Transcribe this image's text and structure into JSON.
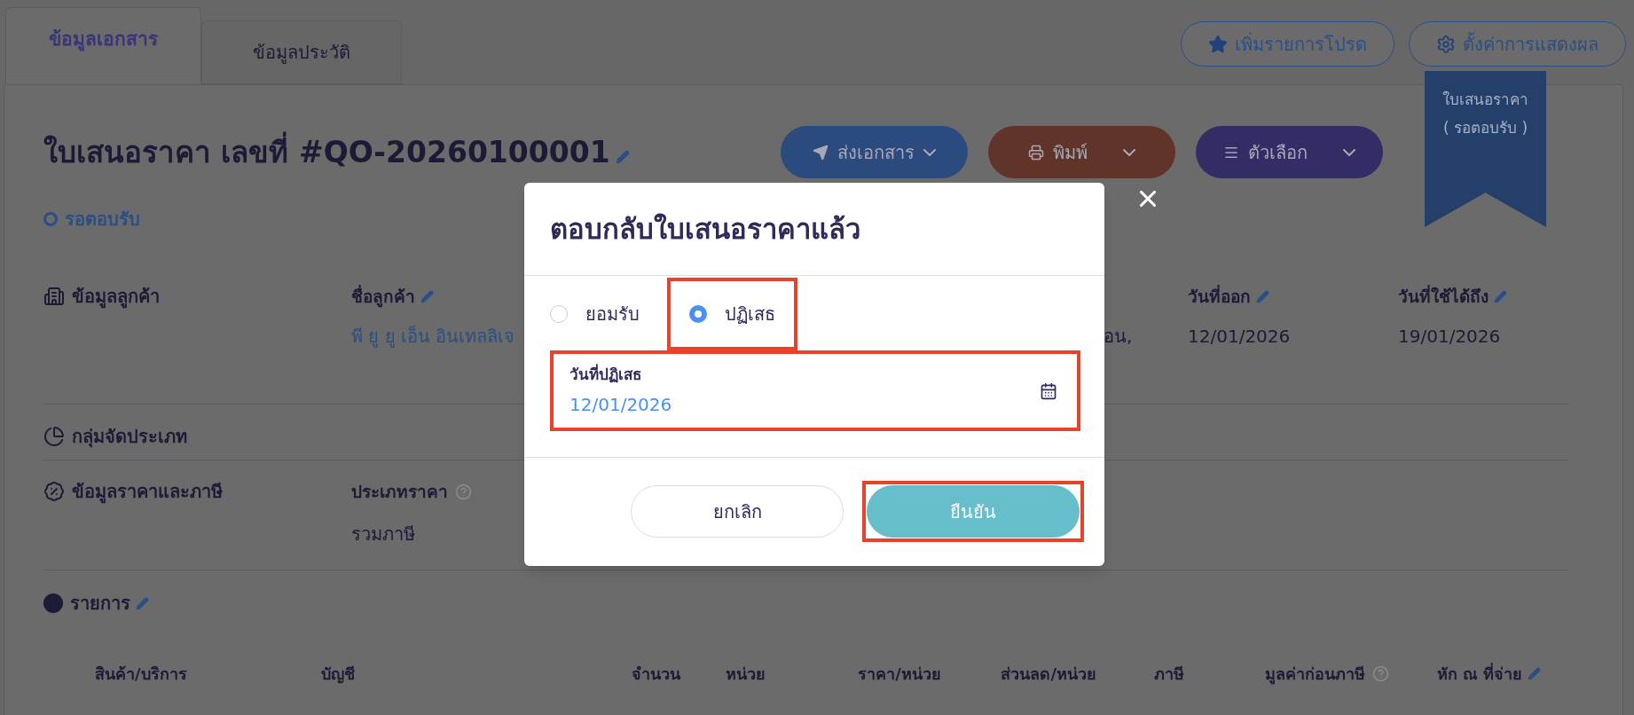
{
  "tabs": [
    {
      "label": "ข้อมูลเอกสาร",
      "selected": true
    },
    {
      "label": "ข้อมูลประวัติ",
      "selected": false
    }
  ],
  "header_buttons": [
    {
      "label": "เพิ่มรายการโปรด"
    },
    {
      "label": "ตั้งค่าการแสดงผล"
    }
  ],
  "ribbon": {
    "lines": [
      "ใบเสนอราคา",
      "( รอตอบรับ )"
    ]
  },
  "document": {
    "title": "ใบเสนอราคา เลขที่ #QO-20260100001",
    "status": "รอตอบรับ"
  },
  "actions": [
    {
      "label": "ส่งเอกสาร",
      "color": "#2b4a7e"
    },
    {
      "label": "พิมพ์",
      "color": "#603428"
    },
    {
      "label": "ตัวเลือก",
      "color": "#322d64"
    }
  ],
  "customer": {
    "title": "ข้อมูลลูกค้า",
    "fields": [
      {
        "label": "ชื่อลูกค้า",
        "value": "พี ยู ยู เอ็น อินเทลลิเจ"
      },
      {
        "value": "อน,"
      },
      {
        "label": "วันที่ออก",
        "value": "12/01/2026"
      },
      {
        "label": "วันที่ใช้ได้ถึง",
        "value": "19/01/2026"
      }
    ]
  },
  "category": {
    "title": "กลุ่มจัดประเภท"
  },
  "pricing": {
    "title": "ข้อมูลราคาและภาษี",
    "field": {
      "label": "ประเภทราคา",
      "value": "รวมภาษี"
    }
  },
  "items": {
    "title": "รายการ",
    "columns": [
      "สินค้า/บริการ",
      "บัญชี",
      "จำนวน",
      "หน่วย",
      "ราคา/หน่วย",
      "ส่วนลด/หน่วย",
      "ภาษี",
      "มูลค่าก่อนภาษี",
      "หัก ณ ที่จ่าย"
    ]
  },
  "modal": {
    "title": "ตอบกลับใบเสนอราคาแล้ว",
    "options": [
      {
        "label": "ยอมรับ",
        "selected": false,
        "highlighted": false
      },
      {
        "label": "ปฏิเสธ",
        "selected": true,
        "highlighted": true
      }
    ],
    "date_field": {
      "label": "วันที่ปฏิเสธ",
      "value": "12/01/2026",
      "highlighted": true
    },
    "buttons": [
      {
        "label": "ยกเลิก",
        "kind": "secondary",
        "highlighted": false
      },
      {
        "label": "ยืนยัน",
        "kind": "primary",
        "highlighted": true
      }
    ]
  }
}
